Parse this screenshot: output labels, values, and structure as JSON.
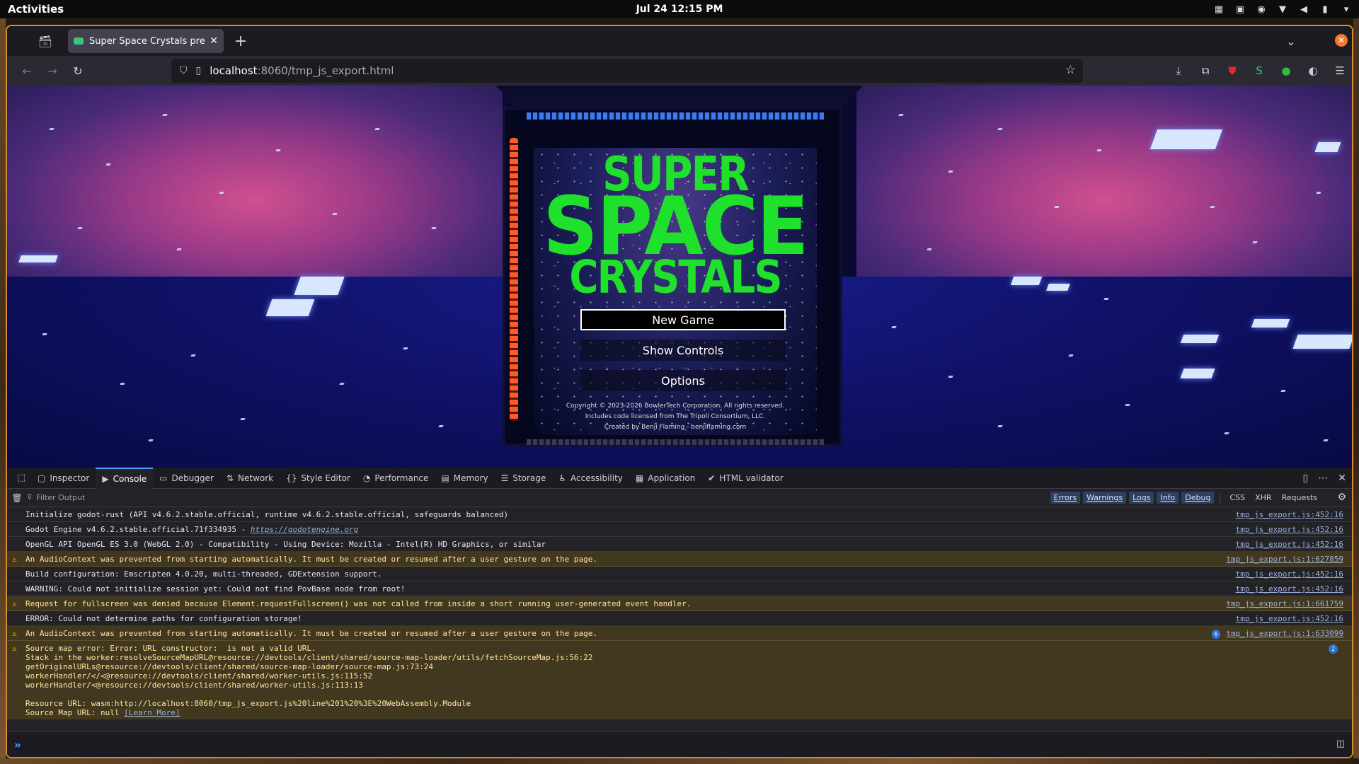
{
  "system": {
    "activities": "Activities",
    "clock": "Jul 24  12:15 PM"
  },
  "browser": {
    "tab_title": "Super Space Crystals pre-al",
    "url_host": "localhost",
    "url_path": ":8060/tmp_js_export.html"
  },
  "game": {
    "logo": {
      "line1": "SUPER",
      "line2": "SPACE",
      "line3": "CRYSTALS"
    },
    "menu": {
      "new_game": "New Game",
      "show_controls": "Show Controls",
      "options": "Options"
    },
    "credits": {
      "copyright": "Copyright © 2023-2026 BowlerTech Corporation.  All rights reserved.",
      "license": "Includes code licensed from The Tripoli Consortium, LLC.",
      "author": "Created by Benji Flaming - benjiflaming.com"
    },
    "colors": {
      "logo": "#1fe02a",
      "accent_light": "#ff5a2a",
      "top_light": "#3b7df0"
    }
  },
  "devtools": {
    "tabs": [
      {
        "label": "Inspector",
        "icon": "inspector-icon"
      },
      {
        "label": "Console",
        "icon": "console-icon"
      },
      {
        "label": "Debugger",
        "icon": "debugger-icon"
      },
      {
        "label": "Network",
        "icon": "network-icon"
      },
      {
        "label": "Style Editor",
        "icon": "style-editor-icon"
      },
      {
        "label": "Performance",
        "icon": "performance-icon"
      },
      {
        "label": "Memory",
        "icon": "memory-icon"
      },
      {
        "label": "Storage",
        "icon": "storage-icon"
      },
      {
        "label": "Accessibility",
        "icon": "accessibility-icon"
      },
      {
        "label": "Application",
        "icon": "application-icon"
      },
      {
        "label": "HTML validator",
        "icon": "html-validator-icon"
      }
    ],
    "active_tab": "Console",
    "filter_placeholder": "Filter Output",
    "levels": [
      "Errors",
      "Warnings",
      "Logs",
      "Info",
      "Debug"
    ],
    "extra_filters": [
      "CSS",
      "XHR",
      "Requests"
    ],
    "messages": [
      {
        "text": "Initialize godot-rust (API v4.6.2.stable.official, runtime v4.6.2.stable.official, safeguards balanced)",
        "src": "tmp_js_export.js:452:16",
        "warn": false
      },
      {
        "text": "Godot Engine v4.6.2.stable.official.71f334935 - ",
        "link": "https://godotengine.org",
        "src": "tmp_js_export.js:452:16",
        "warn": false
      },
      {
        "text": "OpenGL API OpenGL ES 3.0 (WebGL 2.0) - Compatibility - Using Device: Mozilla - Intel(R) HD Graphics, or similar",
        "src": "tmp_js_export.js:452:16",
        "warn": false
      },
      {
        "text": "An AudioContext was prevented from starting automatically. It must be created or resumed after a user gesture on the page.",
        "src": "tmp_js_export.js:1:627859",
        "warn": true
      },
      {
        "text": "Build configuration: Emscripten 4.0.20, multi-threaded, GDExtension support.",
        "src": "tmp_js_export.js:452:16",
        "warn": false
      },
      {
        "text": "WARNING: Could not initialize session yet: Could not find PovBase node from root!",
        "src": "tmp_js_export.js:452:16",
        "warn": false
      },
      {
        "text": "Request for fullscreen was denied because Element.requestFullscreen() was not called from inside a short running user-generated event handler.",
        "src": "tmp_js_export.js:1:661759",
        "warn": true
      },
      {
        "text": "ERROR: Could not determine paths for configuration storage!",
        "src": "tmp_js_export.js:452:16",
        "warn": false
      },
      {
        "text": "An AudioContext was prevented from starting automatically. It must be created or resumed after a user gesture on the page.",
        "src": "tmp_js_export.js:1:633099",
        "warn": true,
        "badge": "6"
      }
    ],
    "source_map_error": {
      "lines": [
        "Source map error: Error: URL constructor:  is not a valid URL.",
        "Stack in the worker:resolveSourceMapURL@resource://devtools/client/shared/source-map-loader/utils/fetchSourceMap.js:56:22",
        "getOriginalURLs@resource://devtools/client/shared/source-map-loader/source-map.js:73:24",
        "workerHandler/</<@resource://devtools/client/shared/worker-utils.js:115:52",
        "workerHandler/<@resource://devtools/client/shared/worker-utils.js:113:13",
        "",
        "Resource URL: wasm:http://localhost:8060/tmp_js_export.js%20line%201%20%3E%20WebAssembly.Module"
      ],
      "last_line": "Source Map URL: null ",
      "learn_more": "[Learn More]",
      "badge": "2"
    }
  }
}
